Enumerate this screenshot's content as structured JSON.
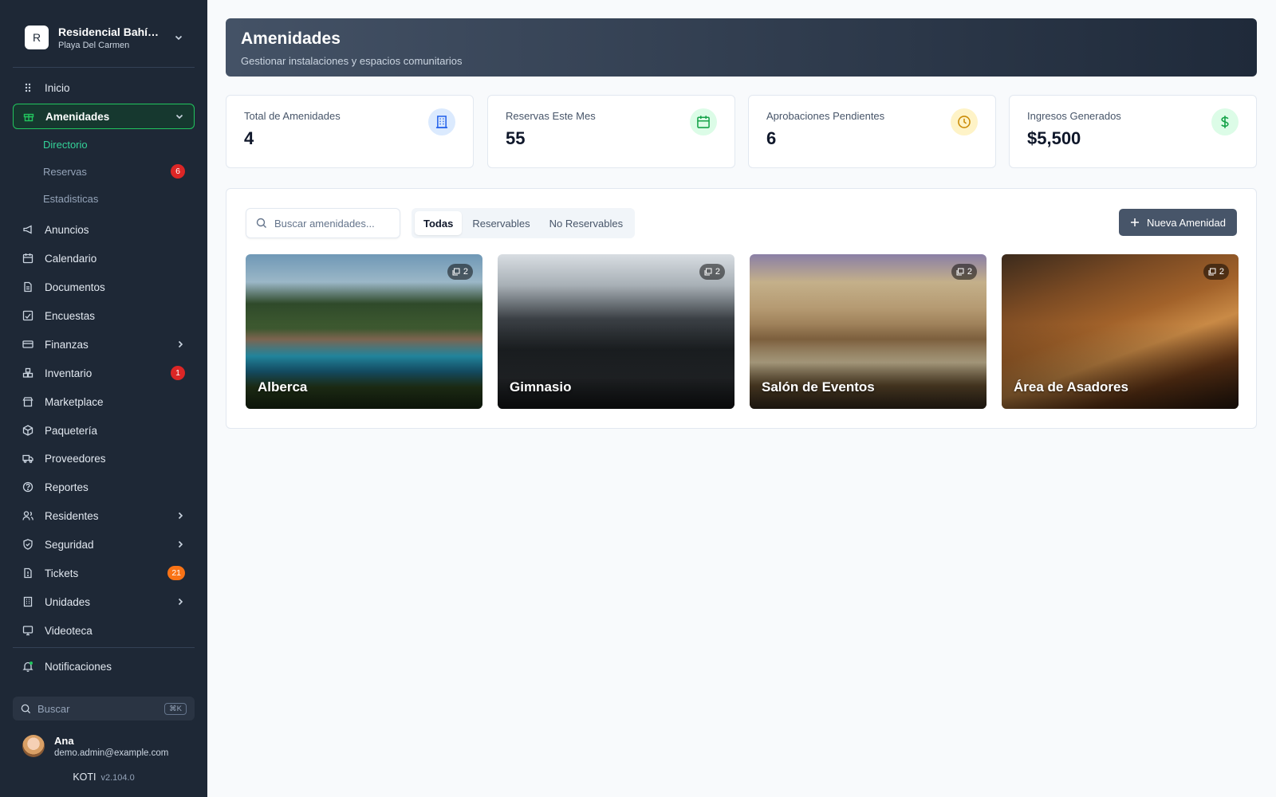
{
  "org": {
    "avatar": "R",
    "name": "Residencial Bahía ...",
    "city": "Playa Del Carmen"
  },
  "nav": [
    {
      "label": "Inicio",
      "icon": "grip-icon"
    },
    {
      "label": "Amenidades",
      "icon": "gift-icon"
    },
    {
      "label": "Anuncios",
      "icon": "megaphone-icon"
    },
    {
      "label": "Calendario",
      "icon": "calendar-icon"
    },
    {
      "label": "Documentos",
      "icon": "document-icon"
    },
    {
      "label": "Encuestas",
      "icon": "poll-icon"
    },
    {
      "label": "Finanzas",
      "icon": "credit-card-icon"
    },
    {
      "label": "Inventario",
      "icon": "boxes-icon",
      "badge": "1"
    },
    {
      "label": "Marketplace",
      "icon": "store-icon"
    },
    {
      "label": "Paquetería",
      "icon": "package-icon"
    },
    {
      "label": "Proveedores",
      "icon": "truck-icon"
    },
    {
      "label": "Reportes",
      "icon": "help-circle-icon"
    },
    {
      "label": "Residentes",
      "icon": "users-icon"
    },
    {
      "label": "Seguridad",
      "icon": "shield-icon"
    },
    {
      "label": "Tickets",
      "icon": "ticket-icon",
      "badge": "21"
    },
    {
      "label": "Unidades",
      "icon": "building-icon"
    },
    {
      "label": "Videoteca",
      "icon": "monitor-icon"
    },
    {
      "label": "Notificaciones",
      "icon": "bell-icon"
    }
  ],
  "subnav": [
    {
      "label": "Directorio"
    },
    {
      "label": "Reservas",
      "badge": "6"
    },
    {
      "label": "Estadisticas"
    }
  ],
  "sidebar_search": {
    "label": "Buscar",
    "shortcut": "⌘K"
  },
  "user": {
    "name": "Ana",
    "email": "demo.admin@example.com"
  },
  "brand": {
    "name": "KOTI",
    "version": "v2.104.0"
  },
  "header": {
    "title": "Amenidades",
    "subtitle": "Gestionar instalaciones y espacios comunitarios"
  },
  "stats": [
    {
      "label": "Total de Amenidades",
      "value": "4",
      "icon": "building-icon",
      "color": "#2563eb",
      "bg": "#dbeafe"
    },
    {
      "label": "Reservas Este Mes",
      "value": "55",
      "icon": "calendar-icon",
      "color": "#16a34a",
      "bg": "#dcfce7"
    },
    {
      "label": "Aprobaciones Pendientes",
      "value": "6",
      "icon": "clock-icon",
      "color": "#ca8a04",
      "bg": "#fef3c7"
    },
    {
      "label": "Ingresos Generados",
      "value": "$5,500",
      "icon": "dollar-icon",
      "color": "#16a34a",
      "bg": "#dcfce7"
    }
  ],
  "search": {
    "placeholder": "Buscar amenidades..."
  },
  "filters": [
    "Todas",
    "Reservables",
    "No Reservables"
  ],
  "new_button": "Nueva Amenidad",
  "amenities": [
    {
      "name": "Alberca",
      "photos": "2"
    },
    {
      "name": "Gimnasio",
      "photos": "2"
    },
    {
      "name": "Salón de Eventos",
      "photos": "2"
    },
    {
      "name": "Área de Asadores",
      "photos": "2"
    }
  ]
}
